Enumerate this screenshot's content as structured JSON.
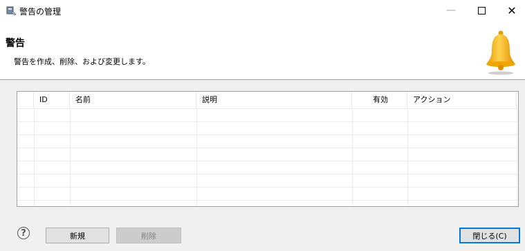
{
  "window": {
    "title": "警告の管理",
    "minimize_glyph": "—",
    "close_glyph": "✕"
  },
  "header": {
    "title": "警告",
    "description": "警告を作成、削除、および変更します。",
    "icon": "bell-icon"
  },
  "table": {
    "columns": [
      "ID",
      "名前",
      "説明",
      "有効",
      "アクション"
    ],
    "rows": []
  },
  "footer": {
    "help_glyph": "?",
    "new_label": "新規",
    "delete_label": "削除",
    "close_label": "閉じる(C)"
  },
  "colors": {
    "accent": "#0078d7",
    "bell": "#f4b400"
  }
}
